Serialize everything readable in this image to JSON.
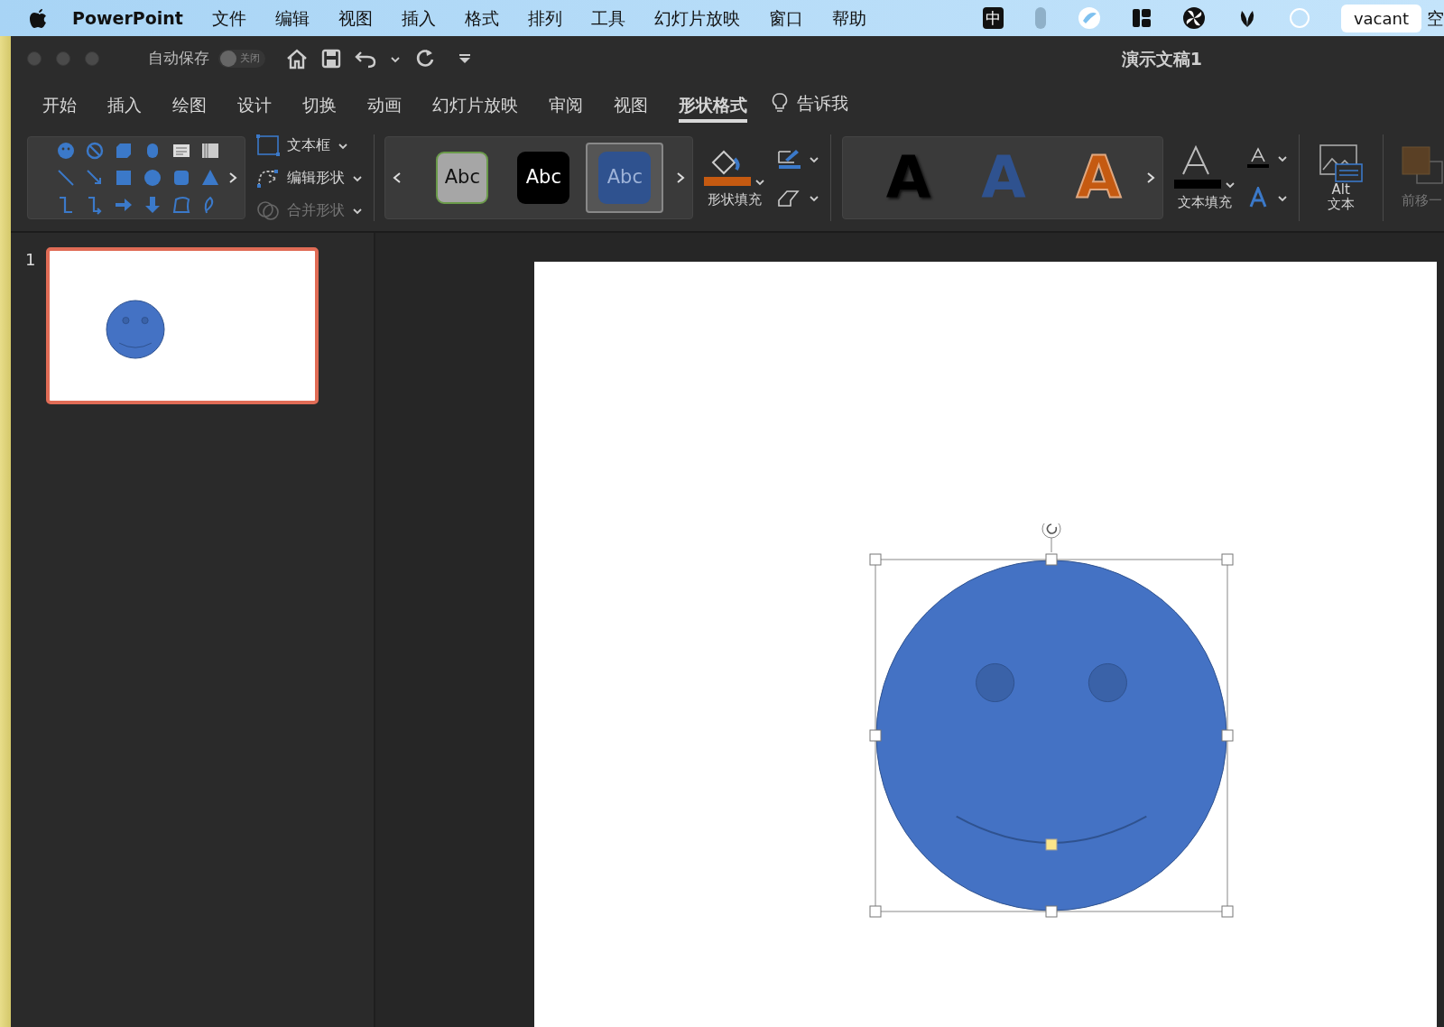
{
  "menubar": {
    "app": "PowerPoint",
    "menus": [
      "文件",
      "编辑",
      "视图",
      "插入",
      "格式",
      "排列",
      "工具",
      "幻灯片放映",
      "窗口",
      "帮助"
    ],
    "input_method": "中",
    "user": "vacant",
    "cut_text": "空"
  },
  "window": {
    "title": "演示文稿1",
    "autosave_label": "自动保存",
    "autosave": {
      "label": "关闭",
      "on": false
    }
  },
  "ribbon_tabs": [
    {
      "label": "开始",
      "selected": false
    },
    {
      "label": "插入",
      "selected": false
    },
    {
      "label": "绘图",
      "selected": false
    },
    {
      "label": "设计",
      "selected": false
    },
    {
      "label": "切换",
      "selected": false
    },
    {
      "label": "动画",
      "selected": false
    },
    {
      "label": "幻灯片放映",
      "selected": false
    },
    {
      "label": "审阅",
      "selected": false
    },
    {
      "label": "视图",
      "selected": false
    },
    {
      "label": "形状格式",
      "selected": true
    }
  ],
  "tell_me": "告诉我",
  "shape_commands": [
    {
      "label": "文本框",
      "disabled": false
    },
    {
      "label": "编辑形状",
      "disabled": false
    },
    {
      "label": "合并形状",
      "disabled": true
    }
  ],
  "shape_styles": [
    {
      "label": "Abc",
      "color": "#a6a6a6",
      "selected": false
    },
    {
      "label": "Abc",
      "color": "#000000",
      "selected": false
    },
    {
      "label": "Abc",
      "color": "#2f528f",
      "selected": true
    }
  ],
  "shape_fill": {
    "label": "形状填充",
    "color": "#c55a11"
  },
  "wordart_styles": [
    {
      "label": "A",
      "color": "#000000"
    },
    {
      "label": "A",
      "color": "#2f528f"
    },
    {
      "label": "A",
      "color": "#c55a11"
    }
  ],
  "text_fill": {
    "label": "文本填充"
  },
  "alt_text": [
    "Alt",
    "文本"
  ],
  "bring_forward": {
    "label": "前移一",
    "disabled": true
  },
  "slides": [
    {
      "number": "1",
      "selected": true
    }
  ],
  "canvas": {
    "shape": {
      "kind": "smiley",
      "selected": true
    }
  }
}
